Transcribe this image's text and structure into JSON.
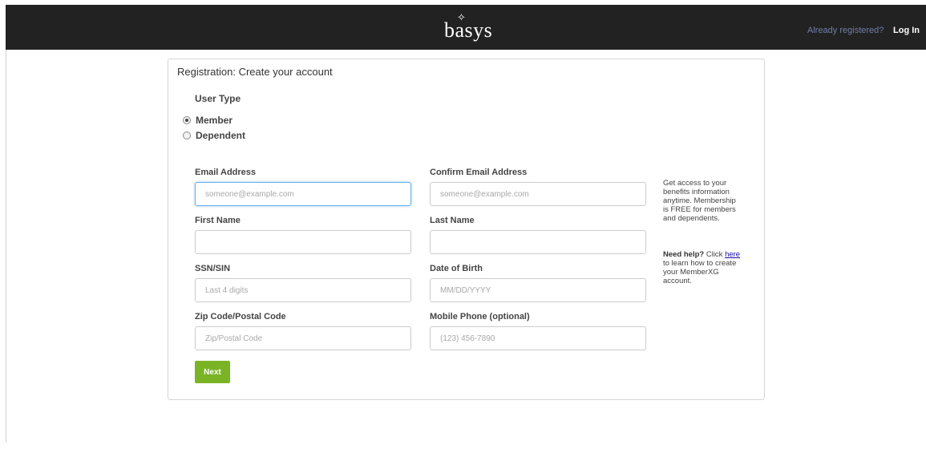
{
  "header": {
    "logo_text": "basys",
    "logo_mark": "✧",
    "already_registered": "Already registered?",
    "login_label": "Log In"
  },
  "form": {
    "title": "Registration: Create your account",
    "user_type_label": "User Type",
    "user_type_options": [
      {
        "label": "Member",
        "selected": true
      },
      {
        "label": "Dependent",
        "selected": false
      }
    ],
    "fields": {
      "email": {
        "label": "Email Address",
        "placeholder": "someone@example.com",
        "value": ""
      },
      "confirm_email": {
        "label": "Confirm Email Address",
        "placeholder": "someone@example.com",
        "value": ""
      },
      "first_name": {
        "label": "First Name",
        "placeholder": "",
        "value": ""
      },
      "last_name": {
        "label": "Last Name",
        "placeholder": "",
        "value": ""
      },
      "ssn": {
        "label": "SSN/SIN",
        "placeholder": "Last 4 digits",
        "value": ""
      },
      "dob": {
        "label": "Date of Birth",
        "placeholder": "MM/DD/YYYY",
        "value": ""
      },
      "zip": {
        "label": "Zip Code/Postal Code",
        "placeholder": "Zip/Postal Code",
        "value": ""
      },
      "mobile": {
        "label": "Mobile Phone (optional)",
        "placeholder": "(123) 456-7890",
        "value": ""
      }
    },
    "next_label": "Next"
  },
  "sidebar": {
    "info_text": "Get access to your benefits information anytime. Membership is FREE for members and dependents.",
    "help_heading": "Need help?",
    "help_pre": " Click ",
    "help_link": "here",
    "help_post": " to learn how to create your MemberXG account."
  },
  "colors": {
    "header_bg": "#222222",
    "accent_green": "#7ab326",
    "focus_blue": "#66afe9",
    "link_blue": "#1a0dab"
  }
}
